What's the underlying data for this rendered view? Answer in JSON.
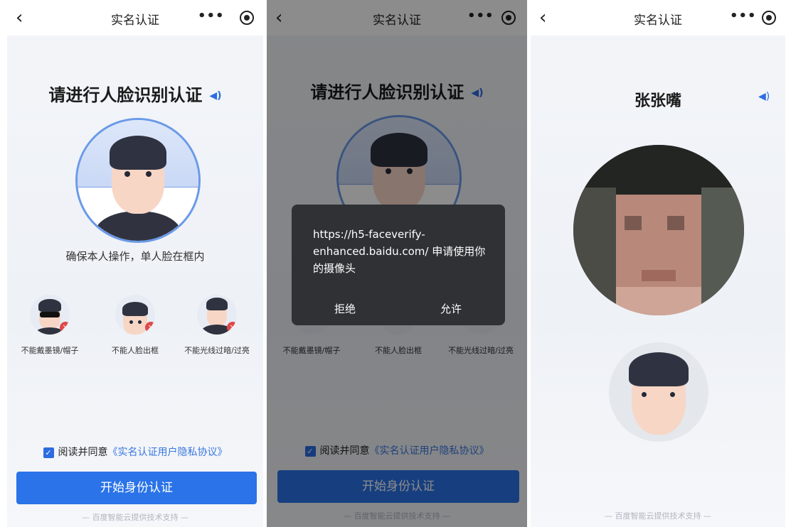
{
  "panels": [
    {
      "nav": {
        "title": "实名认证",
        "back_icon": "chevron-left-icon",
        "more_icon": "ellipsis-icon",
        "target_icon": "record-icon"
      },
      "heading": "请进行人脸识别认证",
      "caption": "确保本人操作，单人脸在框内",
      "tips": [
        {
          "label": "不能戴墨镜/帽子",
          "icon": "sunglasses-face-icon"
        },
        {
          "label": "不能人脸出框",
          "icon": "face-out-of-frame-icon"
        },
        {
          "label": "不能光线过暗/过亮",
          "icon": "lighting-face-icon"
        }
      ],
      "agree": {
        "prefix": "阅读并同意",
        "link": "《实名认证用户隐私协议》"
      },
      "start_button": "开始身份认证",
      "footer": "— 百度智能云提供技术支持 —"
    },
    {
      "nav": {
        "title": "实名认证"
      },
      "heading": "请进行人脸识别认证",
      "tips": [
        {
          "label": "不能戴墨镜/帽子"
        },
        {
          "label": "不能人脸出框"
        },
        {
          "label": "不能光线过暗/过亮"
        }
      ],
      "agree": {
        "prefix": "阅读并同意",
        "link": "《实名认证用户隐私协议》"
      },
      "start_button": "开始身份认证",
      "footer": "— 百度智能云提供技术支持 —",
      "dialog": {
        "message": "https://h5-faceverify-enhanced.baidu.com/ 申请使用你的摄像头",
        "deny": "拒绝",
        "allow": "允许"
      }
    },
    {
      "nav": {
        "title": "实名认证"
      },
      "name": "张张嘴",
      "footer": "— 百度智能云提供技术支持 —"
    }
  ],
  "colors": {
    "accent": "#2a73e8",
    "link": "#3a78e0",
    "error": "#e04848",
    "dialog_bg": "#2f3134"
  }
}
